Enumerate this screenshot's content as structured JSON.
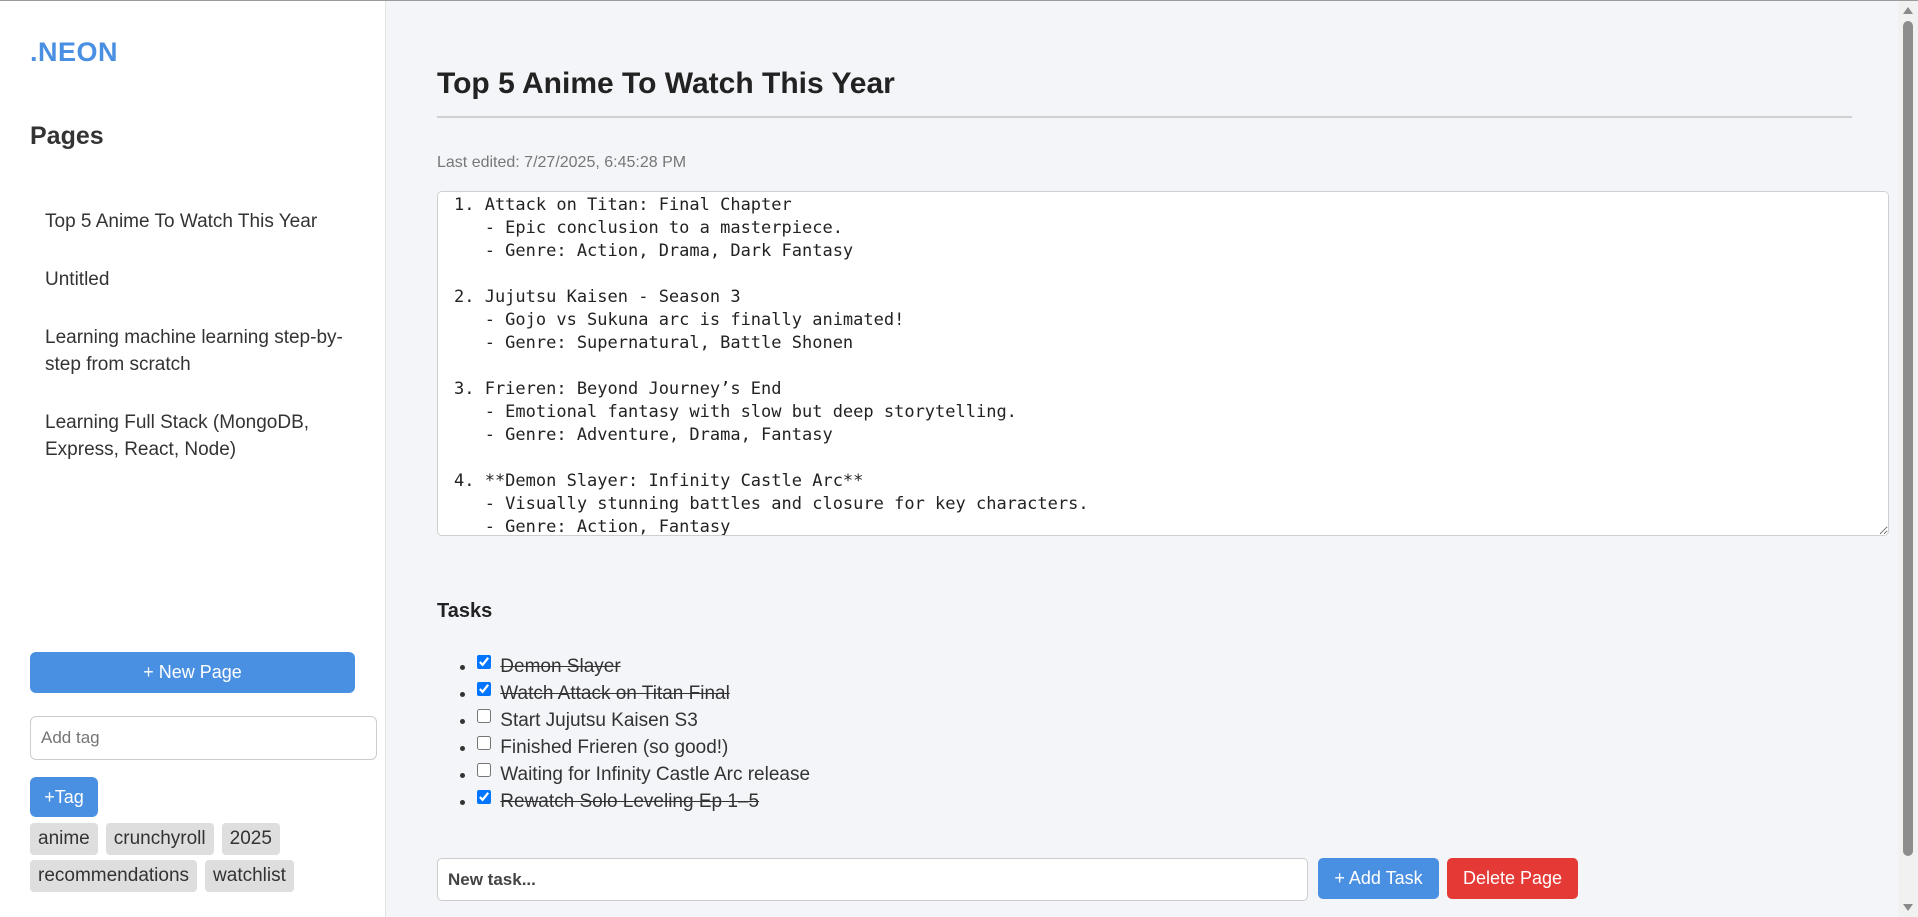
{
  "app": {
    "logo": ".NEON"
  },
  "sidebar": {
    "heading": "Pages",
    "pages": [
      {
        "label": "Top 5 Anime To Watch This Year"
      },
      {
        "label": "Untitled"
      },
      {
        "label": "Learning machine learning step-by-step from scratch"
      },
      {
        "label": "Learning Full Stack (MongoDB, Express, React, Node)"
      }
    ],
    "new_page_label": "+ New Page",
    "tag_input_placeholder": "Add tag",
    "add_tag_label": "+Tag",
    "tags": [
      "anime",
      "crunchyroll",
      "2025",
      "recommendations",
      "watchlist"
    ]
  },
  "main": {
    "title": "Top 5 Anime To Watch This Year",
    "last_edited": "Last edited: 7/27/2025, 6:45:28 PM",
    "content": "1. Attack on Titan: Final Chapter\n   - Epic conclusion to a masterpiece.\n   - Genre: Action, Drama, Dark Fantasy\n\n2. Jujutsu Kaisen - Season 3\n   - Gojo vs Sukuna arc is finally animated!\n   - Genre: Supernatural, Battle Shonen\n\n3. Frieren: Beyond Journey’s End\n   - Emotional fantasy with slow but deep storytelling.\n   - Genre: Adventure, Drama, Fantasy\n\n4. **Demon Slayer: Infinity Castle Arc**\n   - Visually stunning battles and closure for key characters.\n   - Genre: Action, Fantasy",
    "tasks_heading": "Tasks",
    "tasks": [
      {
        "text": "Demon Slayer",
        "done": true
      },
      {
        "text": "Watch Attack on Titan Final",
        "done": true
      },
      {
        "text": "Start Jujutsu Kaisen S3",
        "done": false
      },
      {
        "text": "Finished Frieren (so good!)",
        "done": false
      },
      {
        "text": "Waiting for Infinity Castle Arc release",
        "done": false
      },
      {
        "text": "Rewatch Solo Leveling Ep 1–5",
        "done": true
      }
    ],
    "new_task_placeholder": "New task...",
    "add_task_label": "+ Add Task",
    "delete_page_label": "Delete Page"
  },
  "colors": {
    "accent": "#4a90e2",
    "danger": "#e53935",
    "background": "#f4f5f8"
  }
}
